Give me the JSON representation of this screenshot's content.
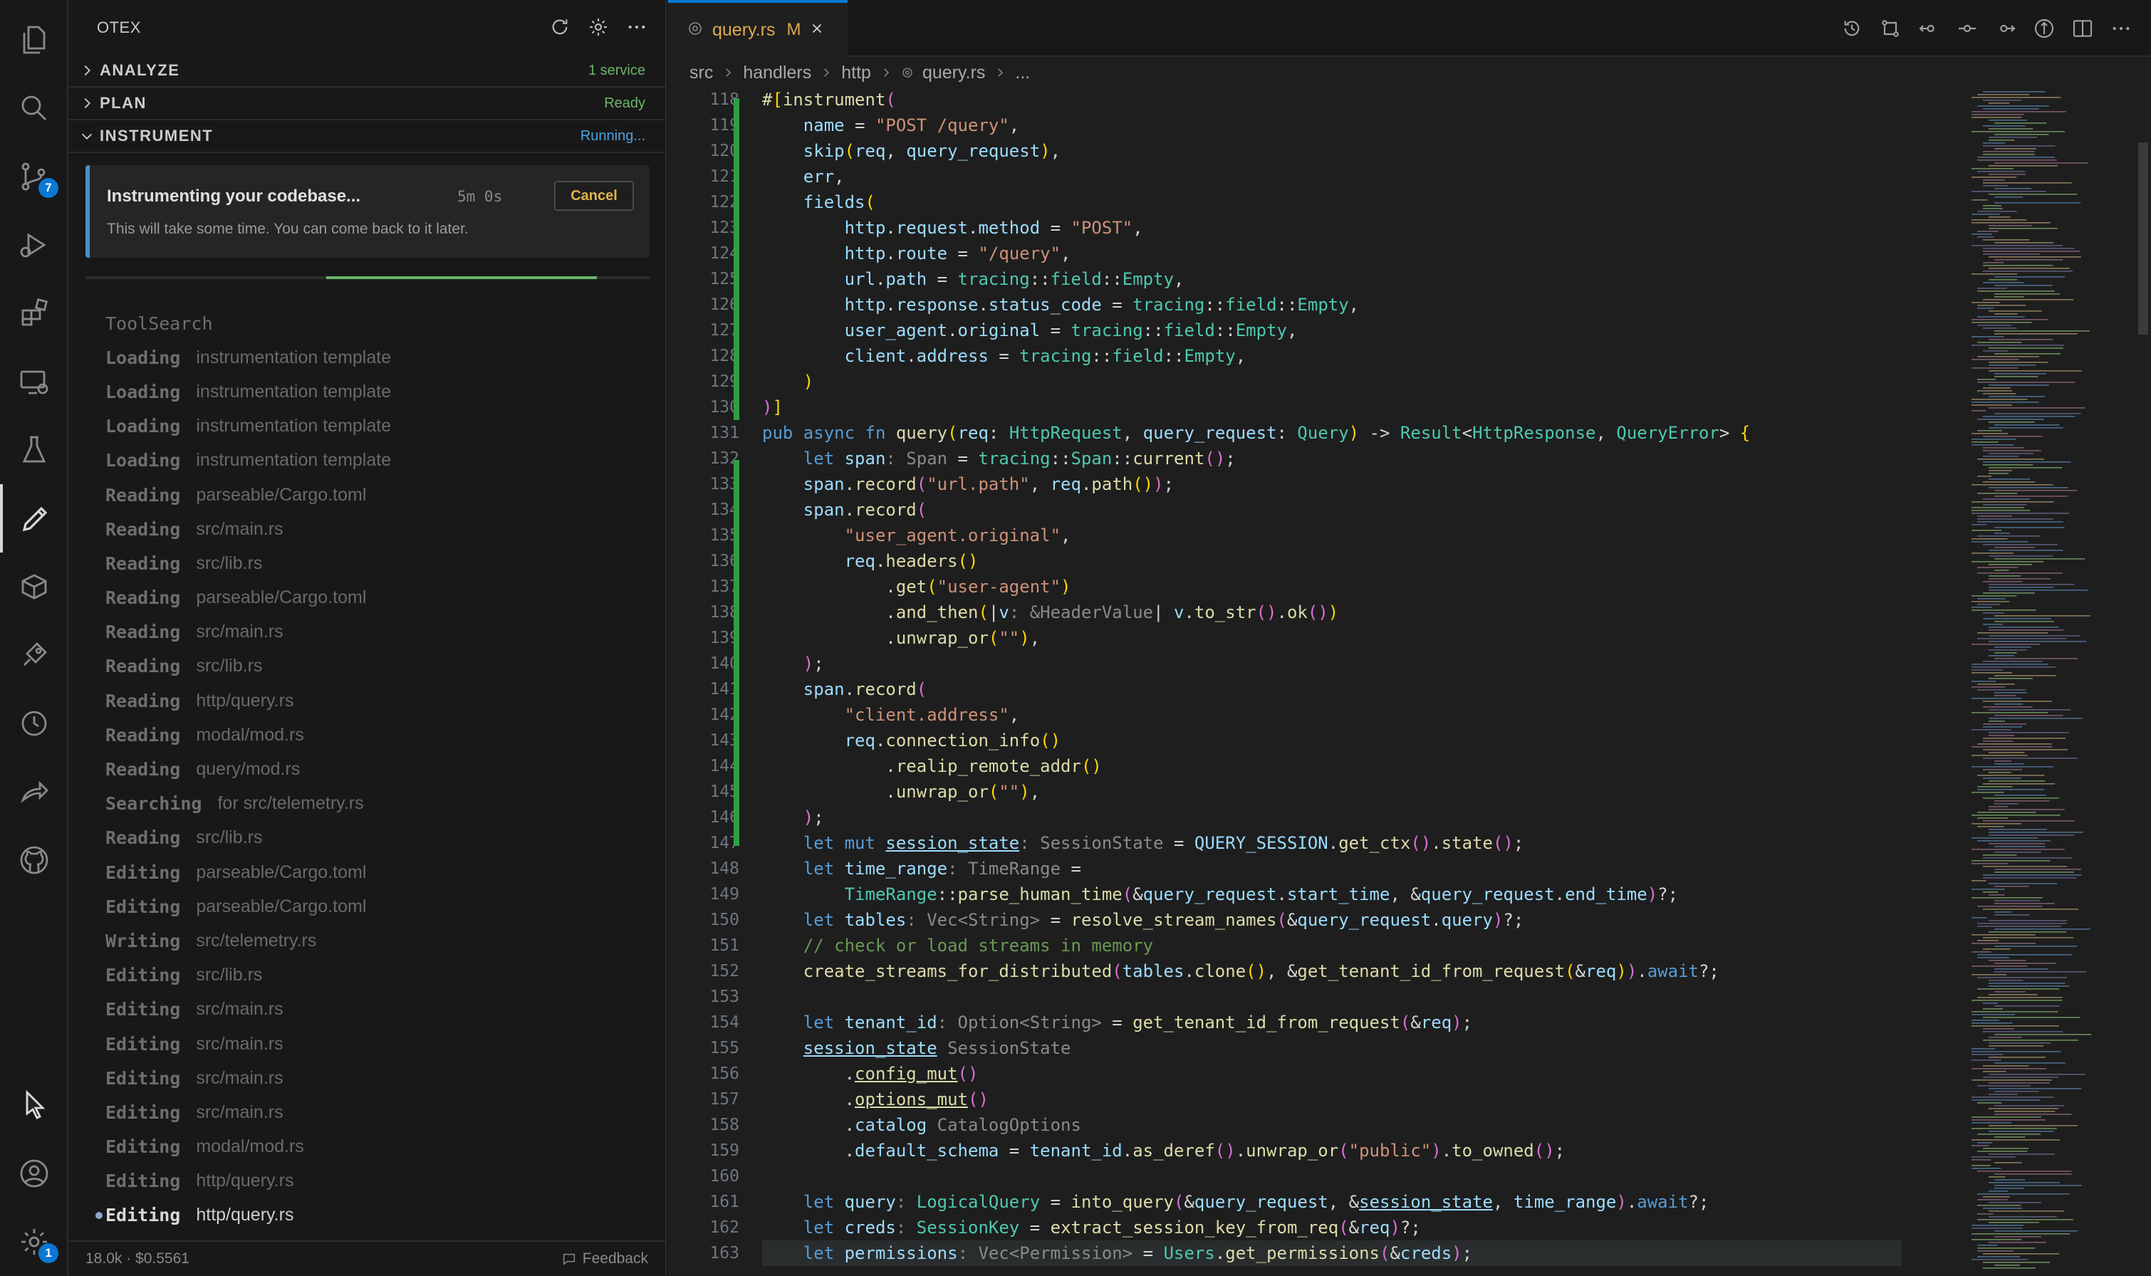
{
  "activity_bar": {
    "scm_badge": "7",
    "settings_badge": "1"
  },
  "side_panel": {
    "title": "OTEX",
    "sections": [
      {
        "label": "ANALYZE",
        "status": "1 service",
        "status_color": "#6ab56a"
      },
      {
        "label": "PLAN",
        "status": "Ready",
        "status_color": "#6ab56a"
      },
      {
        "label": "INSTRUMENT",
        "status": "Running...",
        "status_color": "#4aa3df"
      }
    ],
    "card": {
      "title": "Instrumenting your codebase...",
      "time": "5m 0s",
      "cancel_label": "Cancel",
      "subtitle": "This will take some time. You can come back to it later."
    },
    "log_header": "ToolSearch",
    "log": [
      {
        "verb": "Loading",
        "target": "instrumentation template"
      },
      {
        "verb": "Loading",
        "target": "instrumentation template"
      },
      {
        "verb": "Loading",
        "target": "instrumentation template"
      },
      {
        "verb": "Loading",
        "target": "instrumentation template"
      },
      {
        "verb": "Reading",
        "target": "parseable/Cargo.toml"
      },
      {
        "verb": "Reading",
        "target": "src/main.rs"
      },
      {
        "verb": "Reading",
        "target": "src/lib.rs"
      },
      {
        "verb": "Reading",
        "target": "parseable/Cargo.toml"
      },
      {
        "verb": "Reading",
        "target": "src/main.rs"
      },
      {
        "verb": "Reading",
        "target": "src/lib.rs"
      },
      {
        "verb": "Reading",
        "target": "http/query.rs"
      },
      {
        "verb": "Reading",
        "target": "modal/mod.rs"
      },
      {
        "verb": "Reading",
        "target": "query/mod.rs"
      },
      {
        "verb": "Searching",
        "target": "for src/telemetry.rs"
      },
      {
        "verb": "Reading",
        "target": "src/lib.rs"
      },
      {
        "verb": "Editing",
        "target": "parseable/Cargo.toml"
      },
      {
        "verb": "Editing",
        "target": "parseable/Cargo.toml"
      },
      {
        "verb": "Writing",
        "target": "src/telemetry.rs"
      },
      {
        "verb": "Editing",
        "target": "src/lib.rs"
      },
      {
        "verb": "Editing",
        "target": "src/main.rs"
      },
      {
        "verb": "Editing",
        "target": "src/main.rs"
      },
      {
        "verb": "Editing",
        "target": "src/main.rs"
      },
      {
        "verb": "Editing",
        "target": "src/main.rs"
      },
      {
        "verb": "Editing",
        "target": "modal/mod.rs"
      },
      {
        "verb": "Editing",
        "target": "http/query.rs"
      },
      {
        "verb": "Editing",
        "target": "http/query.rs"
      }
    ],
    "footer_left": "18.0k · $0.5561",
    "footer_right": "Feedback"
  },
  "editor": {
    "tab": {
      "name": "query.rs",
      "modified": "M"
    },
    "breadcrumb": [
      "src",
      "handlers",
      "http",
      "query.rs",
      "..."
    ],
    "first_line": 118
  },
  "colors": {
    "accent": "#0a78d4",
    "modified_tab": "#e0a84e",
    "gutter_added": "#2ea043"
  }
}
